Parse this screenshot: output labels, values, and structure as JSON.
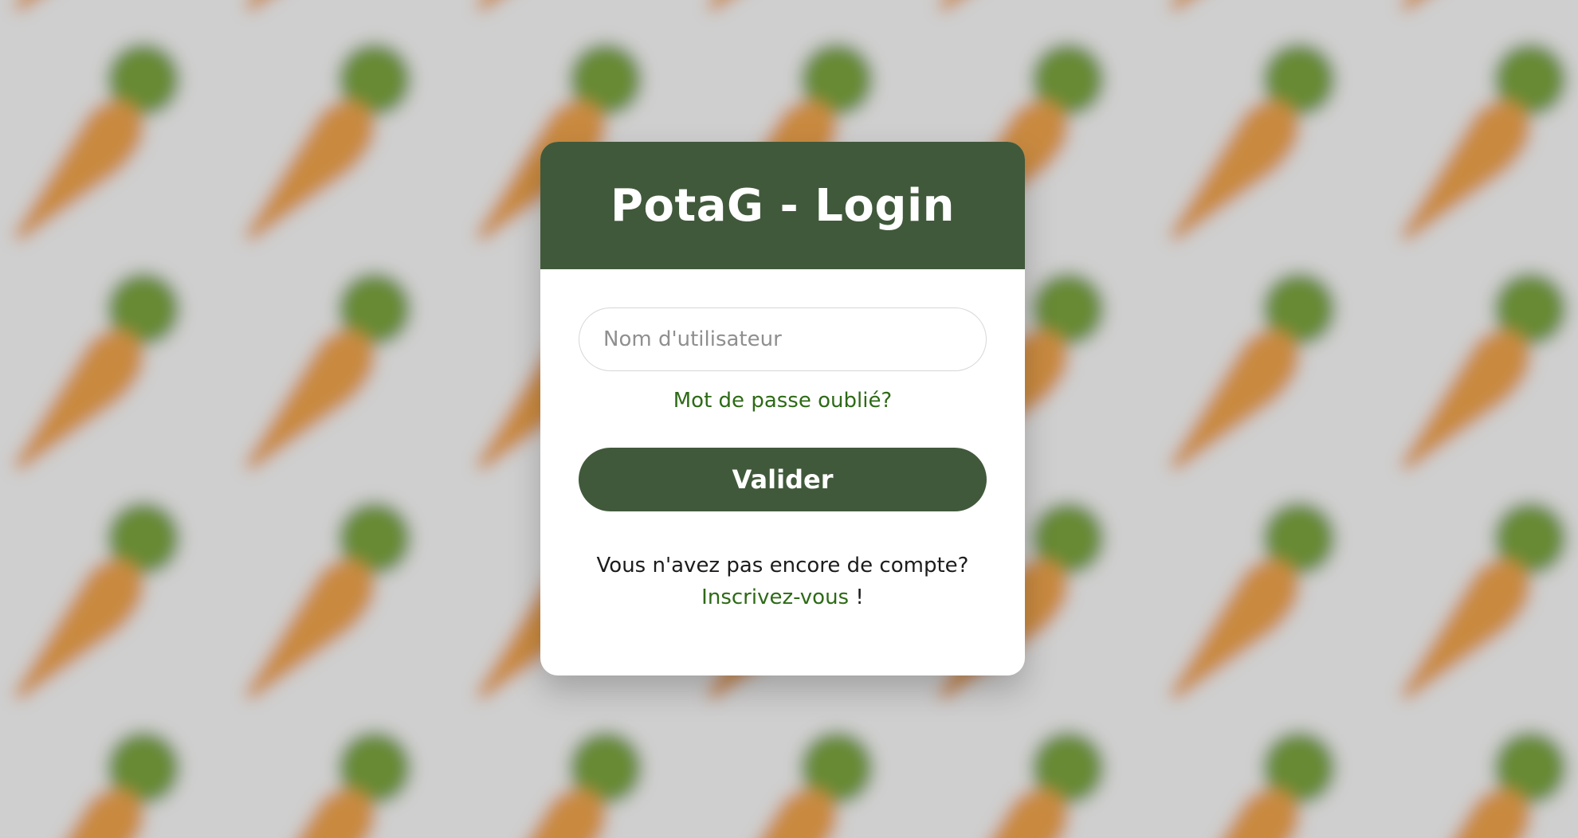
{
  "colors": {
    "background": "#cfcfcf",
    "primary": "#41593b",
    "link": "#2d6a16",
    "carrot": "#c98a3f",
    "carrot_leaves": "#678a35"
  },
  "background": {
    "pattern_icon": "carrot-icon"
  },
  "login": {
    "title": "PotaG - Login",
    "username_placeholder": "Nom d'utilisateur",
    "username_value": "",
    "forgot_password": "Mot de passe oublié?",
    "submit_label": "Valider",
    "signup_prompt": "Vous n'avez pas encore de compte?",
    "signup_link": "Inscrivez-vous",
    "signup_suffix": "!"
  }
}
